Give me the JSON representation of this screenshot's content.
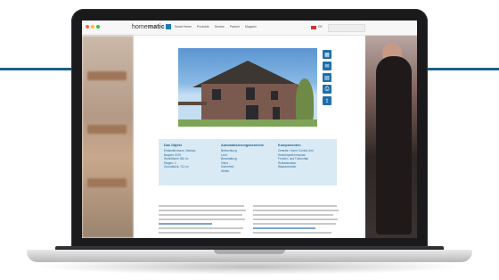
{
  "browser": {
    "dots": [
      "#ff5f57",
      "#febc2e",
      "#28c840"
    ]
  },
  "site": {
    "logo_prefix": "home",
    "logo_bold": "matic",
    "logo_suffix": "IP",
    "menu": [
      "Smart Home",
      "Produkte",
      "Service",
      "Partner",
      "Magazin"
    ],
    "lang": "DE"
  },
  "info_box": {
    "columns": [
      {
        "title": "Das Objekt",
        "items": [
          "Einfamilienhaus, Neubau",
          "Baujahr 2019",
          "Wohnfläche 180 m²",
          "Etagen: 2",
          "Grundstück: 711 m²"
        ]
      },
      {
        "title": "Automatisierungsbereiche",
        "items": [
          "Beleuchtung",
          "Licht",
          "Beschattung",
          "Klima",
          "Sicherheit",
          "Wetter"
        ]
      },
      {
        "title": "Komponenten",
        "items": [
          "Zentrale: Home Control Unit",
          "Heizkörperthermostat",
          "Fenster- und Türkontakt",
          "Rollladenaktor",
          "Wassermelder"
        ]
      }
    ]
  },
  "side_icons": [
    "calendar-icon",
    "chat-icon",
    "document-icon",
    "print-icon",
    "share-icon"
  ]
}
